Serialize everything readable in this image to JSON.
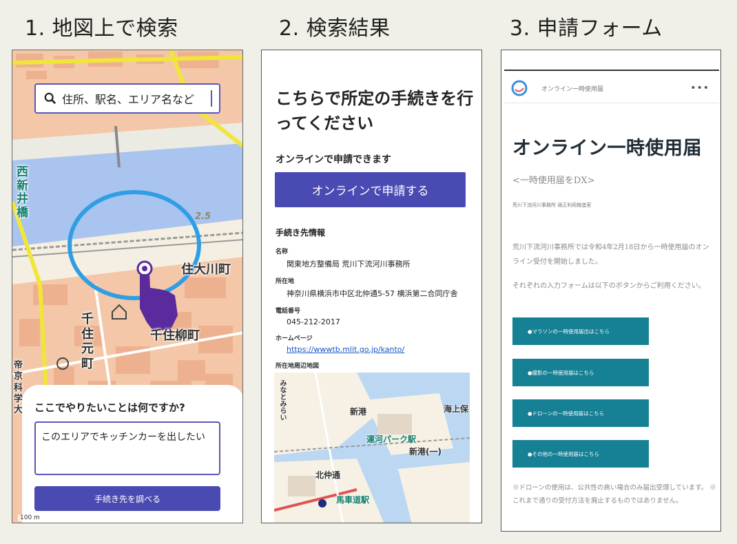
{
  "steps": {
    "step1_title": "1. 地図上で検索",
    "step2_title": "2. 検索結果",
    "step3_title": "3. 申請フォーム"
  },
  "map_screen": {
    "search_placeholder": "住所、駅名、エリア名など",
    "labels": {
      "nishi_arai": "西\n新\n井\n橋",
      "elevation": "2.5",
      "sumida": "住大川町",
      "senju_motomachi": "千\n住\n元\n町",
      "senju_yanagi": "千住柳町",
      "teikyo": "帝\n京\n科\n学\n大"
    },
    "question": "ここでやりたいことは何ですか?",
    "input_value": "このエリアでキッチンカーを出したい",
    "search_button": "手続き先を調べる",
    "scale": "100 m"
  },
  "result_screen": {
    "heading": "こちらで所定の手続きを行ってください",
    "online_sub": "オンラインで申請できます",
    "apply_button": "オンラインで申請する",
    "section_title": "手続き先情報",
    "name_label": "名称",
    "name_value": "関東地方整備局 荒川下流河川事務所",
    "address_label": "所在地",
    "address_value": "神奈川県横浜市中区北仲通5-57 横浜第二合同庁舎",
    "phone_label": "電話番号",
    "phone_value": "045-212-2017",
    "homepage_label": "ホームページ",
    "homepage_value": "https://wwwtb.mlit.go.jp/kanto/",
    "map_label": "所在地周辺地図",
    "map_texts": {
      "minatomirai": "みなとみらい",
      "shinko": "新港",
      "unga_park": "運河パーク駅",
      "shinko1": "新港(一)",
      "kitanaka": "北仲通",
      "bashamichi": "馬車道駅",
      "umi": "海上保"
    }
  },
  "form_screen": {
    "site_name": "オンライン一時使用届",
    "dots": "•••",
    "title": "オンライン一時使用届",
    "subtitle": "<一時使用届をDX>",
    "small_info": "荒川下流河川事務所  適正利用推進室",
    "body1": "荒川下流河川事務所では令和4年2月18日から一時使用届のオンライン受付を開始しました。",
    "body2": "それぞれの入力フォームは以下のボタンからご利用ください。",
    "buttons": [
      "●マラソンの一時使用届出はこちら",
      "●撮影の一時使用届はこちら",
      "●ドローンの一時使用届はこちら",
      "●その他の一時使用届はこちら"
    ],
    "note": "※ドローンの使用は、公共性の高い場合のみ届出受理しています。          ※これまで通りの受付方法を廃止するものではありません。"
  },
  "colors": {
    "primary_button": "#4a4ab3",
    "teal_button": "#168094",
    "map_blue_circle": "#2f9ee5",
    "hand_purple": "#5b2a9c"
  }
}
